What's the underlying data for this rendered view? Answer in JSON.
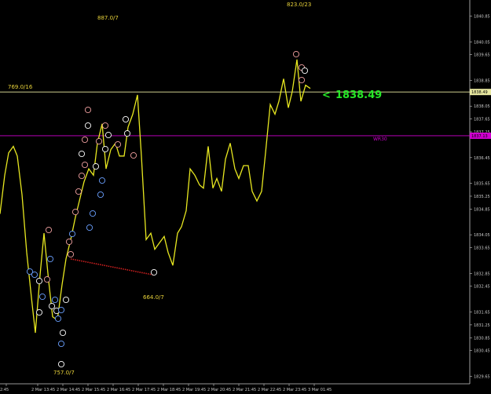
{
  "chart_data": {
    "type": "line",
    "title": "",
    "xlabel": "",
    "ylabel": "",
    "ylim": [
      1829.1,
      1841.35
    ],
    "y_ticks": [
      "1840.85",
      "1840.05",
      "1839.65",
      "1838.85",
      "1838.05",
      "1837.65",
      "1837.25",
      "1836.45",
      "1835.65",
      "1835.25",
      "1834.85",
      "1834.05",
      "1833.65",
      "1832.85",
      "1832.45",
      "1831.65",
      "1831.25",
      "1830.85",
      "1830.45",
      "1829.65"
    ],
    "x_ticks": [
      "2:45",
      "2 Mar 13:45",
      "2 Mar 14:45",
      "2 Mar 15:45",
      "2 Mar 16:45",
      "2 Mar 17:45",
      "2 Mar 18:45",
      "2 Mar 19:45",
      "2 Mar 20:45",
      "2 Mar 21:45",
      "2 Mar 22:45",
      "2 Mar 23:45",
      "3 Mar 01:45"
    ],
    "series": [
      {
        "color": "#e8e820",
        "x": [
          0,
          6,
          11,
          17,
          22,
          28,
          34,
          40,
          45,
          51,
          56,
          62,
          67,
          73,
          79,
          84,
          90,
          96,
          102,
          107,
          113,
          119,
          124,
          130,
          135,
          141,
          147,
          152,
          158,
          163,
          169,
          175,
          180,
          186,
          192,
          197,
          203,
          209,
          214,
          220,
          226,
          231,
          237,
          242,
          248,
          254,
          259,
          265,
          271,
          276,
          282,
          287,
          293,
          299,
          304,
          310,
          316,
          321,
          327,
          333,
          338,
          344,
          350,
          355,
          361,
          367,
          372,
          378,
          383,
          389,
          395
        ],
        "y": [
          1834.7,
          1835.9,
          1836.6,
          1836.8,
          1836.5,
          1835.3,
          1833.5,
          1832.1,
          1831.0,
          1832.8,
          1834.1,
          1832.6,
          1831.5,
          1831.4,
          1832.5,
          1833.3,
          1833.9,
          1834.6,
          1835.2,
          1835.7,
          1836.1,
          1835.9,
          1836.9,
          1837.5,
          1836.1,
          1836.7,
          1836.9,
          1836.5,
          1836.5,
          1837.4,
          1837.8,
          1838.4,
          1836.5,
          1833.9,
          1834.1,
          1833.6,
          1833.8,
          1834.0,
          1833.5,
          1833.1,
          1834.1,
          1834.3,
          1834.8,
          1836.1,
          1835.9,
          1835.6,
          1835.5,
          1836.8,
          1835.5,
          1835.8,
          1835.4,
          1836.4,
          1836.9,
          1836.1,
          1835.8,
          1836.2,
          1836.2,
          1835.4,
          1835.1,
          1835.4,
          1836.6,
          1838.1,
          1837.8,
          1838.2,
          1838.9,
          1838.0,
          1838.5,
          1839.5,
          1838.2,
          1838.7,
          1838.6
        ]
      }
    ],
    "hlines": [
      {
        "value": 1838.49,
        "color": "#e8e8a0"
      },
      {
        "value": 1837.13,
        "color": "#d000d0",
        "label": "WR30"
      }
    ],
    "annotations": [
      {
        "text": "823.0/23"
      },
      {
        "text": "887.0/7"
      },
      {
        "text": "769.0/16"
      },
      {
        "text": "664.0/7"
      },
      {
        "text": "757.0/7"
      }
    ],
    "current_price": "1838.49",
    "price_boxes": [
      "1838.49",
      "1837.13"
    ],
    "arrow_symbol": "<",
    "grid": false
  }
}
